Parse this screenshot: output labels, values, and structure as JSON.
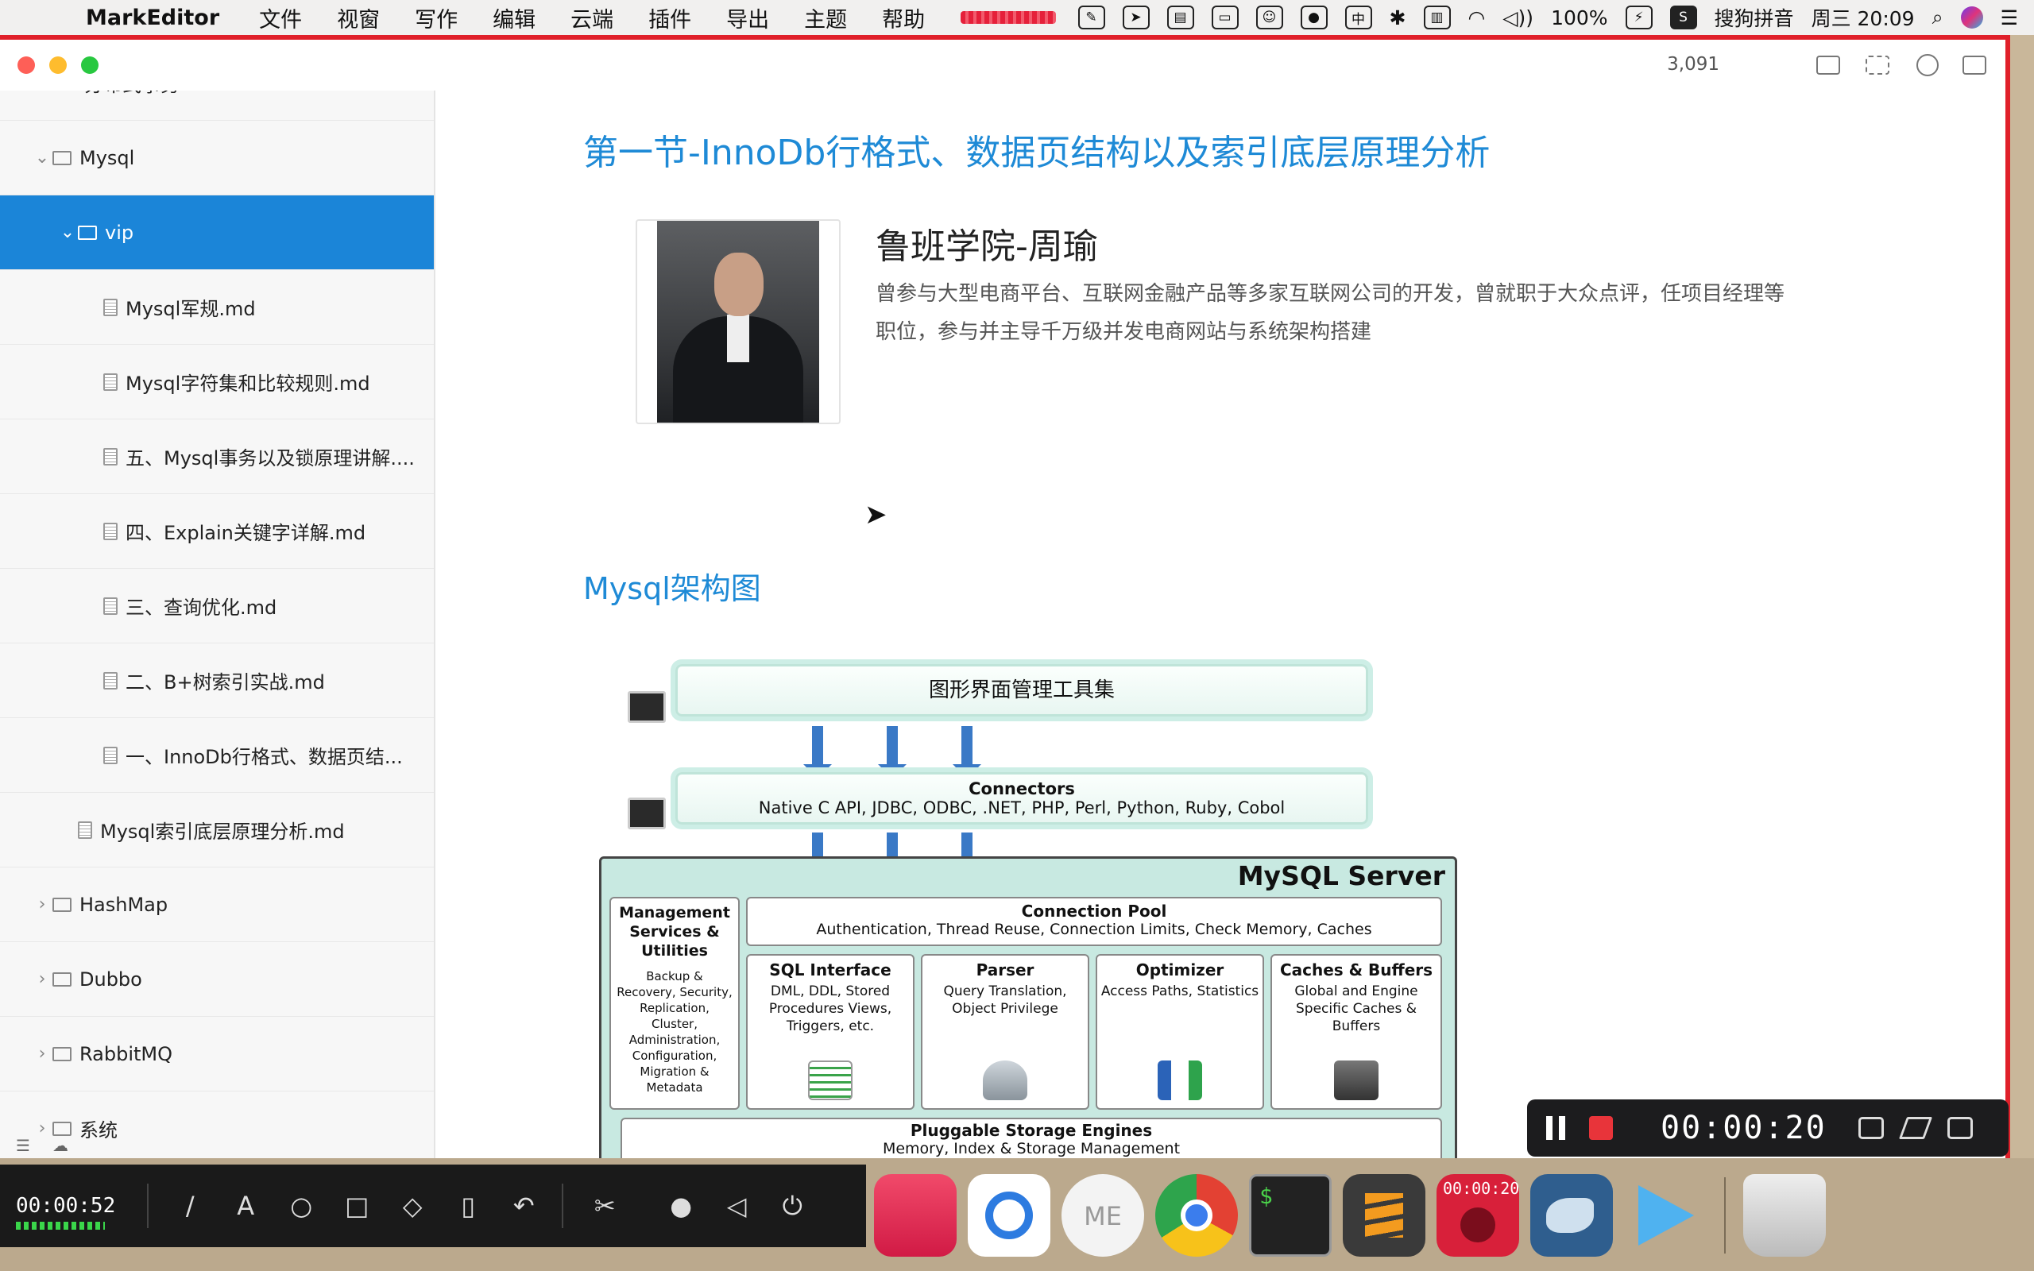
{
  "menubar": {
    "app_name": "MarkEditor",
    "items": [
      "文件",
      "视窗",
      "写作",
      "编辑",
      "云端",
      "插件",
      "导出",
      "主题",
      "帮助"
    ],
    "battery": "100%",
    "input_method": "搜狗拼音",
    "clock": "周三 20:09"
  },
  "window": {
    "word_count": "3,091"
  },
  "sidebar": {
    "rows": [
      {
        "label": "分布式事务",
        "type": "folder",
        "indent": 1,
        "expanded": false
      },
      {
        "label": "Mysql",
        "type": "folder",
        "indent": 1,
        "expanded": true
      },
      {
        "label": "vip",
        "type": "folder",
        "indent": 2,
        "expanded": true,
        "selected": true
      },
      {
        "label": "Mysql军规.md",
        "type": "file",
        "indent": 3
      },
      {
        "label": "Mysql字符集和比较规则.md",
        "type": "file",
        "indent": 3
      },
      {
        "label": "五、Mysql事务以及锁原理讲解....",
        "type": "file",
        "indent": 3
      },
      {
        "label": "四、Explain关键字详解.md",
        "type": "file",
        "indent": 3
      },
      {
        "label": "三、查询优化.md",
        "type": "file",
        "indent": 3
      },
      {
        "label": "二、B+树索引实战.md",
        "type": "file",
        "indent": 3
      },
      {
        "label": "一、InnoDb行格式、数据页结...",
        "type": "file",
        "indent": 3
      },
      {
        "label": "Mysql索引底层原理分析.md",
        "type": "file",
        "indent": 2
      },
      {
        "label": "HashMap",
        "type": "folder",
        "indent": 1,
        "expanded": false
      },
      {
        "label": "Dubbo",
        "type": "folder",
        "indent": 1,
        "expanded": false
      },
      {
        "label": "RabbitMQ",
        "type": "folder",
        "indent": 1,
        "expanded": false
      },
      {
        "label": "系统",
        "type": "folder",
        "indent": 1,
        "expanded": false
      }
    ]
  },
  "document": {
    "heading": "第一节-InnoDb行格式、数据页结构以及索引底层原理分析",
    "author_name": "鲁班学院-周瑜",
    "author_bio": "曾参与大型电商平台、互联网金融产品等多家互联网公司的开发，曾就职于大众点评，任项目经理等职位，参与并主导千万级并发电商网站与系统架构搭建",
    "section_heading": "Mysql架构图",
    "diagram": {
      "gui_tools": "图形界面管理工具集",
      "connectors_title": "Connectors",
      "connectors_body": "Native C API, JDBC, ODBC, .NET, PHP, Perl, Python, Ruby, Cobol",
      "server_title": "MySQL Server",
      "management_title": "Management Services & Utilities",
      "management_body": "Backup & Recovery, Security, Replication, Cluster, Administration, Configuration, Migration & Metadata",
      "pool_title": "Connection Pool",
      "pool_body": "Authentication, Thread Reuse, Connection Limits, Check Memory, Caches",
      "sql_title": "SQL Interface",
      "sql_body": "DML, DDL, Stored Procedures Views, Triggers, etc.",
      "parser_title": "Parser",
      "parser_body": "Query Translation, Object Privilege",
      "optimizer_title": "Optimizer",
      "optimizer_body": "Access Paths, Statistics",
      "caches_title": "Caches & Buffers",
      "caches_body": "Global and Engine Specific Caches & Buffers",
      "engines_title": "Pluggable Storage Engines",
      "engines_body": "Memory, Index & Storage Management"
    }
  },
  "recorder": {
    "timer": "00:00:20",
    "elapsed": "00:00:52",
    "dock_badge": "00:00:20"
  },
  "dock": {
    "markeditor_label": "ME"
  }
}
